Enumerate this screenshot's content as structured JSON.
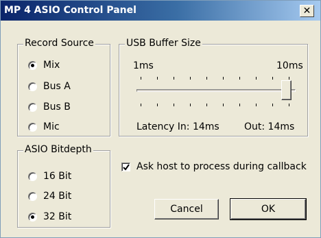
{
  "window": {
    "title": "MP 4 ASIO Control Panel",
    "close_glyph": "✕"
  },
  "record_source": {
    "legend": "Record Source",
    "options": [
      "Mix",
      "Bus A",
      "Bus B",
      "Mic"
    ],
    "selected": "Mix"
  },
  "usb_buffer": {
    "legend": "USB Buffer Size",
    "min_label": "1ms",
    "max_label": "10ms",
    "slider_position_fraction": 1.0,
    "latency_in": "Latency In: 14ms",
    "latency_out": "Out: 14ms"
  },
  "asio_bitdepth": {
    "legend": "ASIO Bitdepth",
    "options": [
      "16 Bit",
      "24 Bit",
      "32 Bit"
    ],
    "selected": "32 Bit"
  },
  "ask_host": {
    "label": "Ask host to process during callback",
    "checked": true
  },
  "buttons": {
    "cancel": "Cancel",
    "ok": "OK"
  },
  "icons": {
    "close": "close-icon",
    "radio": "radio-icon",
    "checkbox": "checkmark-icon"
  }
}
